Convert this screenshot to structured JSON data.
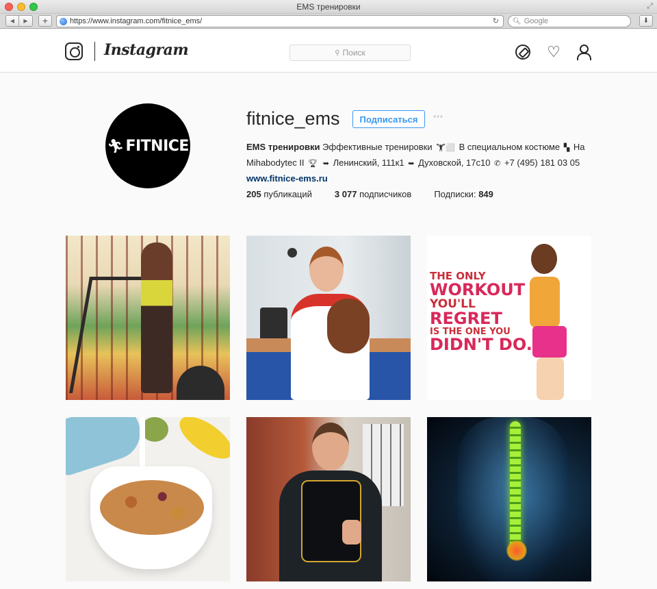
{
  "window": {
    "title": "EMS тренировки",
    "url": "https://www.instagram.com/fitnice_ems/",
    "search_placeholder": "Google"
  },
  "header": {
    "wordmark": "Instagram",
    "search_placeholder": "Поиск"
  },
  "profile": {
    "username": "fitnice_ems",
    "avatar_text": "FITNICE",
    "follow_label": "Подписаться",
    "more_label": "°°°",
    "bio": {
      "name": "EMS тренировки",
      "line1": "Эффективные тренировки",
      "line1_tail": "В специальном костюме",
      "line2_start": "На Mihabodytec II",
      "address1": "Ленинский, 111к1",
      "address2": "Духовской, 17с10",
      "phone": "+7 (495) 181 03 05",
      "website": "www.fitnice-ems.ru"
    },
    "stats": {
      "posts_count": "205",
      "posts_label": "публикаций",
      "followers_count": "3 077",
      "followers_label": "подписчиков",
      "following_label": "Подписки:",
      "following_count": "849"
    }
  },
  "posts": {
    "quote_lines": [
      "THE ONLY",
      "WORKOUT",
      "YOU'LL",
      "REGRET",
      "IS THE ONE YOU",
      "DIDN'T DO."
    ]
  },
  "colors": {
    "accent": "#3897f0",
    "link": "#003569",
    "border": "#dbdbdb"
  }
}
